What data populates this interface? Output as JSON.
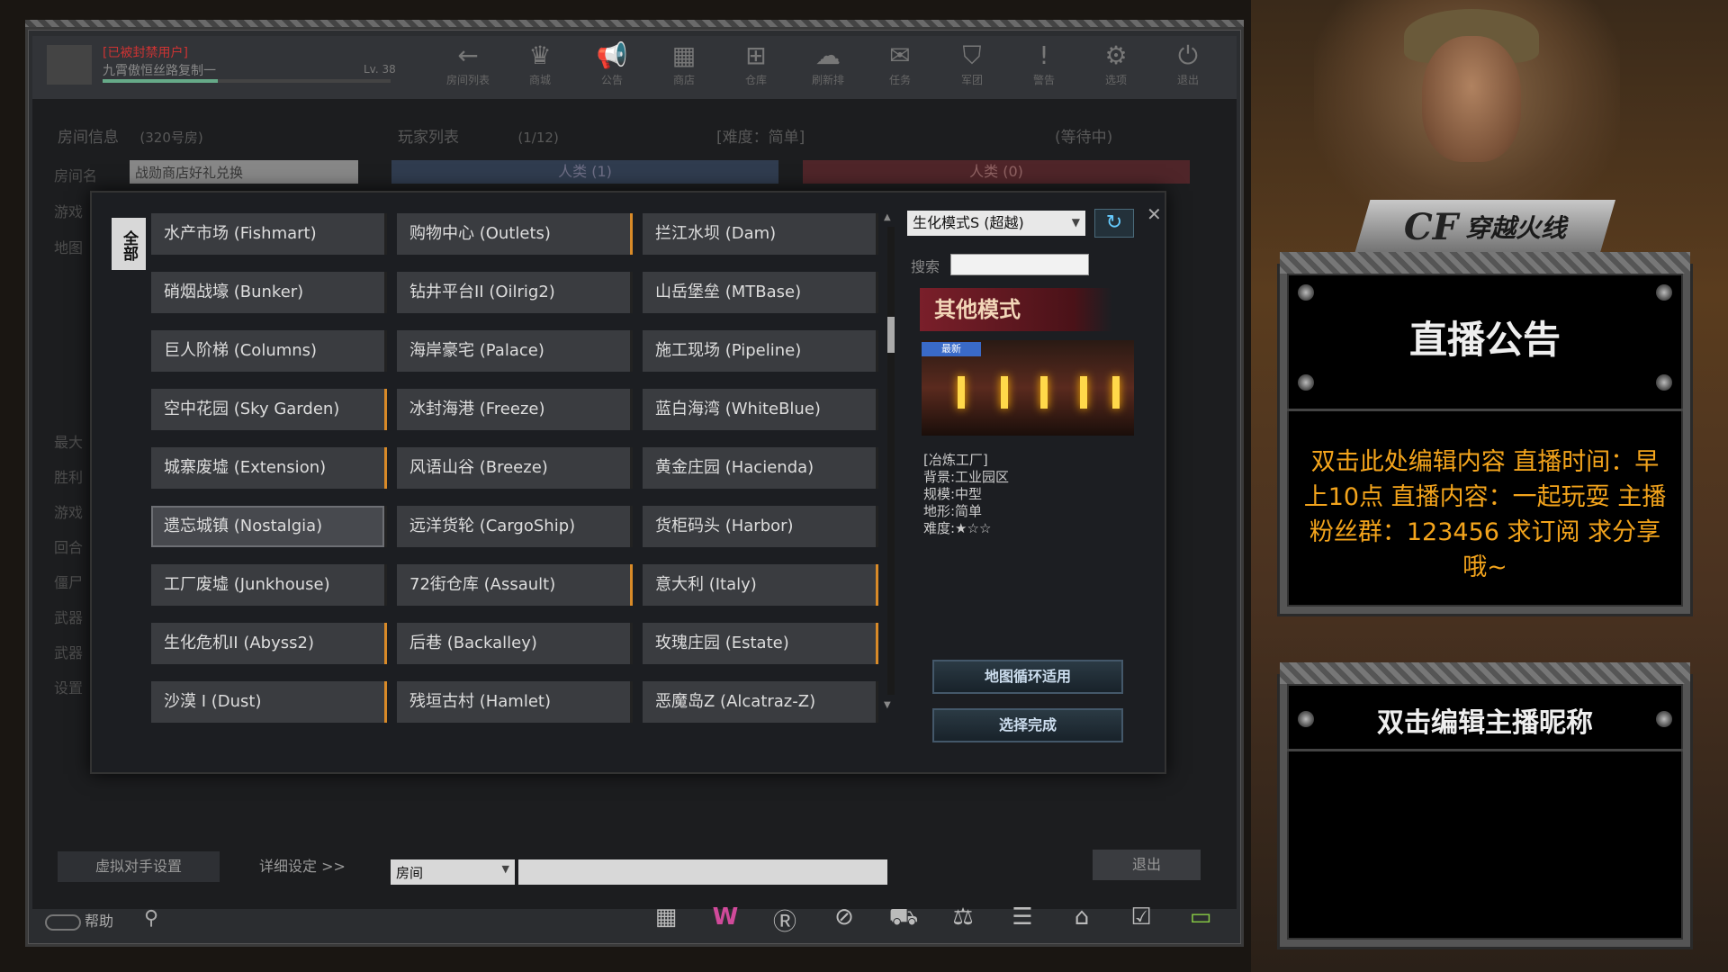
{
  "player": {
    "name": "[已被封禁用户]",
    "sub": "九霄傲恒丝路复制一",
    "level": "Lv. 38"
  },
  "nav": [
    {
      "label": "房间列表",
      "icon": "←"
    },
    {
      "label": "商城",
      "icon": "♛"
    },
    {
      "label": "公告",
      "icon": "📢"
    },
    {
      "label": "商店",
      "icon": "▦"
    },
    {
      "label": "仓库",
      "icon": "⊞"
    },
    {
      "label": "刷新排",
      "icon": "☁"
    },
    {
      "label": "任务",
      "icon": "✉"
    },
    {
      "label": "军团",
      "icon": "⛉"
    },
    {
      "label": "警告",
      "icon": "!"
    },
    {
      "label": "选项",
      "icon": "⚙"
    },
    {
      "label": "退出",
      "icon": "⏻"
    }
  ],
  "room": {
    "header": "房间信息",
    "room_no": "(320号房)",
    "name_label": "房间名",
    "name_value": "战勋商店好礼兑换",
    "game_label": "游戏",
    "map_label": "地图"
  },
  "side_labels": [
    "最大",
    "胜利",
    "游戏",
    "回合",
    "僵尸",
    "武器",
    "武器",
    "设置"
  ],
  "players": {
    "header": "玩家列表",
    "count": "(1/12)",
    "difficulty": "[难度：简单]",
    "status": "(等待中)",
    "team_a": "人类 (1)",
    "team_b": "人类 (0)"
  },
  "all_tab": "全部",
  "maps": [
    [
      "水产市场 (Fishmart)",
      "硝烟战壕 (Bunker)",
      "巨人阶梯 (Columns)",
      "空中花园 (Sky Garden)",
      "城寨废墟 (Extension)",
      "遗忘城镇 (Nostalgia)",
      "工厂废墟 (Junkhouse)",
      "生化危机II (Abyss2)",
      "沙漠 I (Dust)"
    ],
    [
      "购物中心 (Outlets)",
      "钻井平台II (Oilrig2)",
      "海岸豪宅 (Palace)",
      "冰封海港 (Freeze)",
      "风语山谷 (Breeze)",
      "远洋货轮 (CargoShip)",
      "72街仓库 (Assault)",
      "后巷 (Backalley)",
      "残垣古村 (Hamlet)"
    ],
    [
      "拦江水坝 (Dam)",
      "山岳堡垒 (MTBase)",
      "施工现场 (Pipeline)",
      "蓝白海湾 (WhiteBlue)",
      "黄金庄园 (Hacienda)",
      "货柜码头 (Harbor)",
      "意大利 (Italy)",
      "玫瑰庄园 (Estate)",
      "恶魔岛Z (Alcatraz-Z)"
    ]
  ],
  "selected_map": "遗忘城镇 (Nostalgia)",
  "mode_select": "生化模式S (超越)",
  "search_label": "搜索",
  "mode_banner": "其他模式",
  "new_tag": "最新",
  "map_info": [
    "[冶炼工厂]",
    "背景:工业园区",
    "规模:中型",
    "地形:简单",
    "难度:★☆☆"
  ],
  "btn_loop": "地图循环适用",
  "btn_done": "选择完成",
  "bottom": {
    "bot_settings": "虚拟对手设置",
    "details": "详细设定 >>",
    "chat_channel": "房间",
    "leave": "退出",
    "help": "帮助"
  },
  "announce": {
    "title": "直播公告",
    "body": "双击此处编辑内容 直播时间：早上10点 直播内容：一起玩耍 主播粉丝群：123456 求订阅 求分享哦~"
  },
  "nick": {
    "title": "双击编辑主播昵称"
  },
  "logo": {
    "cf": "CF",
    "name": "穿越火线"
  },
  "colors": {
    "accent_orange": "#f3a41c",
    "team_blue": "#4a5c7a",
    "team_red": "#7a3a40"
  }
}
